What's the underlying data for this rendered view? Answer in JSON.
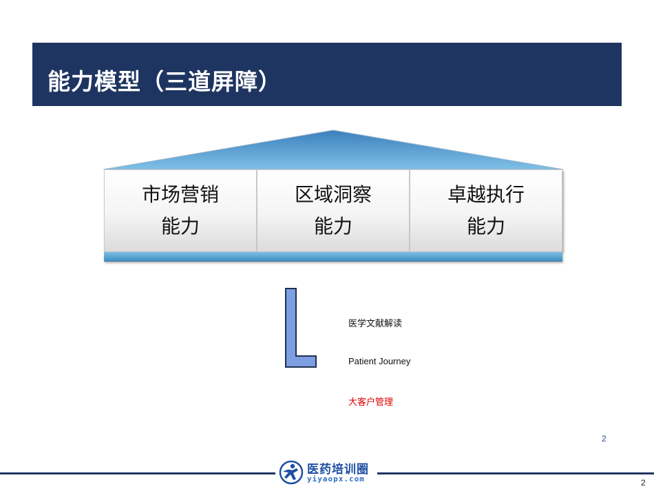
{
  "slide": {
    "title": "能力模型（三道屏障）",
    "pillars": [
      {
        "line1": "市场营销",
        "line2": "能力"
      },
      {
        "line1": "区域洞察",
        "line2": "能力"
      },
      {
        "line1": "卓越执行",
        "line2": "能力"
      }
    ],
    "list_items": [
      {
        "text": "医学文献解读",
        "color": "#111111"
      },
      {
        "text": "Patient Journey",
        "color": "#111111"
      },
      {
        "text": "大客户管理",
        "color": "#e00000"
      }
    ],
    "slide_number": "2",
    "page_number": "2"
  },
  "footer": {
    "logo_name": "医药培训圈",
    "logo_url": "yiyaopx.com",
    "logo_icon": "running-figure-icon"
  },
  "colors": {
    "title_bar": "#1f3561",
    "roof": "#4a8fc6",
    "base": "#3f8fc4",
    "l_shape": "#7d9ee0",
    "highlight": "#e00000"
  }
}
